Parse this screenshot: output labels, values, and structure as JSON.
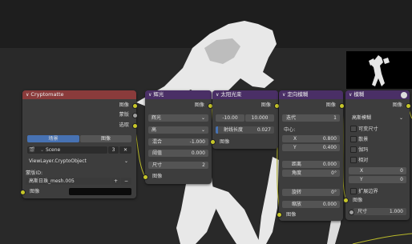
{
  "colors": {
    "socket_yellow": "#c7c729",
    "socket_purple": "#6363c7",
    "header_red": "#8a3b3b",
    "header_purple": "#4a2f66",
    "field_blue": "#4772b3"
  },
  "crypto": {
    "title": "Cryptomatte",
    "out_image": "图像",
    "out_mask": "蒙版",
    "out_pick": "选取",
    "tab_scene": "场景",
    "tab_image": "图像",
    "scene_icon": "scene-icon",
    "scene_name": "Scene",
    "scene_num": "3",
    "view_layer": "ViewLayer.CryptoObject",
    "matte_label": "蒙版ID:",
    "matte_value": "高斯日珠_mesh.005",
    "plus": "+",
    "minus": "−",
    "in_image": "图像"
  },
  "glare": {
    "title": "辉光",
    "out_image": "图像",
    "type": "辉光",
    "quality": "高",
    "mix_label": "混合",
    "mix_value": "-1.000",
    "threshold_label": "阈值",
    "threshold_value": "0.000",
    "size_label": "尺寸",
    "size_value": "2",
    "in_image": "图像"
  },
  "sunbeams": {
    "title": "太阳光束",
    "out_image": "图像",
    "source_x": "-10.00",
    "source_y": "10.000",
    "ray_label": "射线长度",
    "ray_value": "0.027",
    "in_image": "图像"
  },
  "dblur": {
    "title": "定向模糊",
    "out_image": "图像",
    "iter_label": "迭代",
    "iter_value": "1",
    "center_label": "中心:",
    "x_label": "X",
    "x_value": "0.800",
    "y_label": "Y",
    "y_value": "0.400",
    "dist_label": "距离",
    "dist_value": "0.000",
    "angle_label": "角度",
    "angle_value": "0°",
    "spin_label": "旋转",
    "spin_value": "0°",
    "zoom_label": "缩放",
    "zoom_value": "0.000",
    "in_image": "图像"
  },
  "blur": {
    "title": "模糊",
    "out_image": "图像",
    "filter": "高斯模糊",
    "variable_size": "可变尺寸",
    "bokeh": "散景",
    "gamma": "伽玛",
    "relative": "相对",
    "x_label": "X",
    "x_value": "0",
    "y_label": "Y",
    "y_value": "0",
    "extend": "扩展边界",
    "in_image": "图像",
    "size_label": "尺寸",
    "size_value": "1.000"
  }
}
